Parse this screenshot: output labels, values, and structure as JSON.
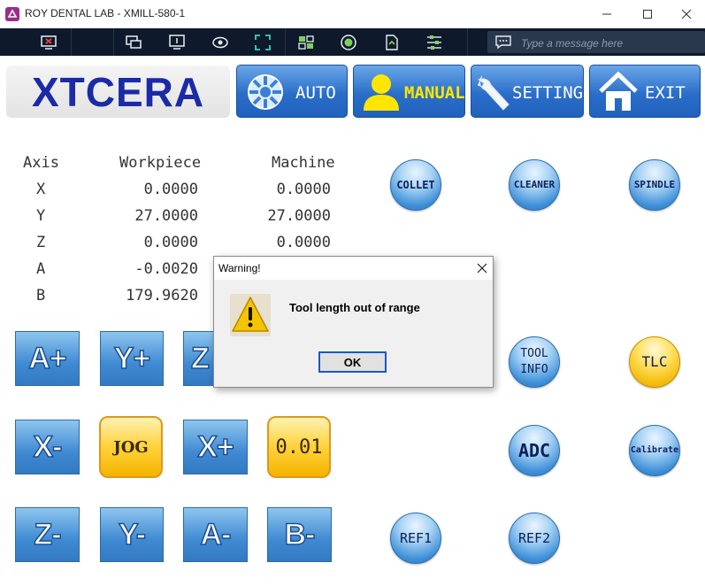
{
  "window": {
    "title": "ROY DENTAL LAB - XMILL-580-1"
  },
  "toolbar": {
    "icons": [
      "close-session-icon",
      "switch-monitor-icon",
      "monitor-icon",
      "eye-icon",
      "fullscreen-icon",
      "settings-toggle-icon",
      "record-icon",
      "file-transfer-icon",
      "actions-icon"
    ],
    "message_placeholder": "Type a message here"
  },
  "logo": {
    "text": "XTCERA"
  },
  "nav": {
    "auto": "AUTO",
    "manual": "MANUAL",
    "setting": "SETTING",
    "exit": "EXIT"
  },
  "axes": {
    "headers": {
      "axis": "Axis",
      "workpiece": "Workpiece",
      "machine": "Machine"
    },
    "rows": [
      {
        "axis": "X",
        "workpiece": "0.0000",
        "machine": "0.0000"
      },
      {
        "axis": "Y",
        "workpiece": "27.0000",
        "machine": "27.0000"
      },
      {
        "axis": "Z",
        "workpiece": "0.0000",
        "machine": "0.0000"
      },
      {
        "axis": "A",
        "workpiece": "-0.0020",
        "machine": ""
      },
      {
        "axis": "B",
        "workpiece": "179.9620",
        "machine": ""
      }
    ]
  },
  "round_buttons": {
    "collet": "COLLET",
    "cleaner": "CLEANER",
    "spindle": "SPINDLE",
    "tool_info_1": "TOOL",
    "tool_info_2": "INFO",
    "tlc": "TLC",
    "adc": "ADC",
    "calibrate": "Calibrate",
    "ref1": "REF1",
    "ref2": "REF2"
  },
  "jog": {
    "a_plus": "A+",
    "y_plus": "Y+",
    "z_plus": "Z",
    "x_minus": "X-",
    "jog": "JOG",
    "x_plus": "X+",
    "step": "0.01",
    "z_minus": "Z-",
    "y_minus": "Y-",
    "a_minus": "A-",
    "b_minus": "B-"
  },
  "dialog": {
    "title": "Warning!",
    "message": "Tool length out of range",
    "ok": "OK"
  },
  "colors": {
    "brand": "#1b2aa6",
    "button_blue": "#2a6ec9",
    "accent_yellow": "#ffd23a",
    "toolbar": "#0e1a2b"
  }
}
